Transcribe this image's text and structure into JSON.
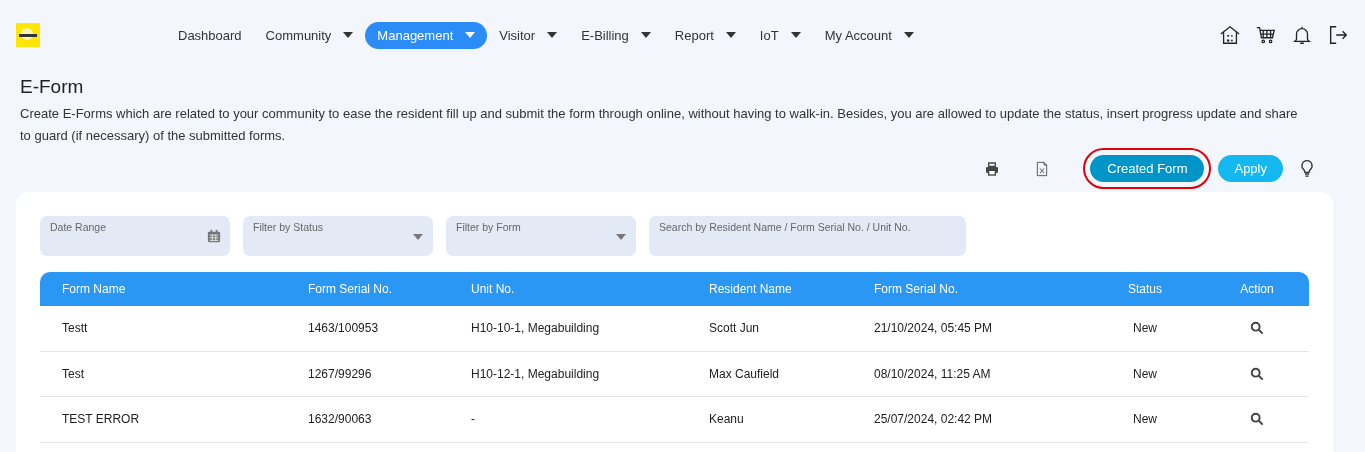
{
  "nav": {
    "items": [
      {
        "label": "Dashboard",
        "dropdown": false,
        "selected": false
      },
      {
        "label": "Community",
        "dropdown": true,
        "selected": false
      },
      {
        "label": "Management",
        "dropdown": true,
        "selected": true
      },
      {
        "label": "Visitor",
        "dropdown": true,
        "selected": false
      },
      {
        "label": "E-Billing",
        "dropdown": true,
        "selected": false
      },
      {
        "label": "Report",
        "dropdown": true,
        "selected": false
      },
      {
        "label": "IoT",
        "dropdown": true,
        "selected": false
      },
      {
        "label": "My Account",
        "dropdown": true,
        "selected": false
      }
    ]
  },
  "page": {
    "title": "E-Form",
    "description": "Create E-Forms which are related to your community to ease the resident fill up and submit the form through online, without having to walk-in. Besides, you are allowed to update the status, insert progress update and share to guard (if necessary) of the submitted forms."
  },
  "toolbar": {
    "buttons": [
      {
        "label": "Created Form",
        "highlighted": true
      },
      {
        "label": "Apply",
        "highlighted": false
      }
    ]
  },
  "filters": [
    {
      "kind": "date",
      "placeholder": "Date Range"
    },
    {
      "kind": "select",
      "placeholder": "Filter by Status"
    },
    {
      "kind": "select",
      "placeholder": "Filter by Form"
    },
    {
      "kind": "search",
      "placeholder": "Search by Resident Name / Form Serial No. / Unit No."
    }
  ],
  "table": {
    "columns": [
      "Form Name",
      "Form Serial No.",
      "Unit No.",
      "Resident Name",
      "Form Serial No.",
      "Status",
      "Action"
    ],
    "rows": [
      {
        "form_name": "Testt",
        "serial": "1463/100953",
        "unit": "H10-10-1, Megabuilding",
        "resident": "Scott Jun",
        "date": "21/10/2024, 05:45 PM",
        "status": "New"
      },
      {
        "form_name": "Test",
        "serial": "1267/99296",
        "unit": "H10-12-1, Megabuilding",
        "resident": "Max Caufield",
        "date": "08/10/2024, 11:25 AM",
        "status": "New"
      },
      {
        "form_name": "TEST ERROR",
        "serial": "1632/90063",
        "unit": "-",
        "resident": "Keanu",
        "date": "25/07/2024, 02:42 PM",
        "status": "New"
      }
    ]
  }
}
